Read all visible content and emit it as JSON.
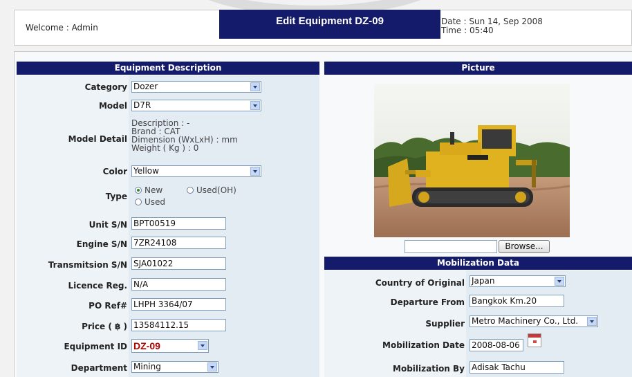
{
  "header": {
    "welcome": "Welcome : Admin",
    "title": "Edit Equipment DZ-09",
    "date": "Date : Sun 14, Sep 2008",
    "time": "Time : 05:40"
  },
  "equipment_description": {
    "heading": "Equipment Description",
    "category": {
      "label": "Category",
      "value": "Dozer"
    },
    "model": {
      "label": "Model",
      "value": "D7R"
    },
    "model_detail": {
      "label": "Model Detail",
      "description": "Description : -",
      "brand": "Brand : CAT",
      "dimension": "Dimension (WxLxH) : mm",
      "weight": "Weight ( Kg ) : 0"
    },
    "color": {
      "label": "Color",
      "value": "Yellow"
    },
    "type": {
      "label": "Type",
      "options": [
        "New",
        "Used(OH)",
        "Used"
      ],
      "selected": "New"
    },
    "unit_sn": {
      "label": "Unit S/N",
      "value": "BPT00519"
    },
    "engine_sn": {
      "label": "Engine S/N",
      "value": "7ZR24108"
    },
    "transmission_sn": {
      "label": "Transmitsion S/N",
      "value": "SJA01022"
    },
    "licence_reg": {
      "label": "Licence Reg.",
      "value": "N/A"
    },
    "po_ref": {
      "label": "PO Ref#",
      "value": "LHPH 3364/07"
    },
    "price": {
      "label": "Price ( ฿ )",
      "value": "13584112.15"
    },
    "equipment_id": {
      "label": "Equipment ID",
      "value": "DZ-09"
    },
    "department": {
      "label": "Department",
      "value": "Mining"
    }
  },
  "picture": {
    "heading": "Picture",
    "browse_label": "Browse...",
    "file_value": ""
  },
  "mobilization": {
    "heading": "Mobilization Data",
    "country": {
      "label": "Country of Original",
      "value": "Japan"
    },
    "departure": {
      "label": "Departure From",
      "value": "Bangkok Km.20"
    },
    "supplier": {
      "label": "Supplier",
      "value": "Metro Machinery Co., Ltd."
    },
    "date": {
      "label": "Mobilization Date",
      "value": "2008-08-06"
    },
    "by": {
      "label": "Mobilization By",
      "value": "Adisak Tachu"
    }
  },
  "colors": {
    "accent": "#141b6a",
    "id_text": "#b00000"
  },
  "icons": [
    "calendar-icon",
    "dropdown-arrow-icon"
  ]
}
